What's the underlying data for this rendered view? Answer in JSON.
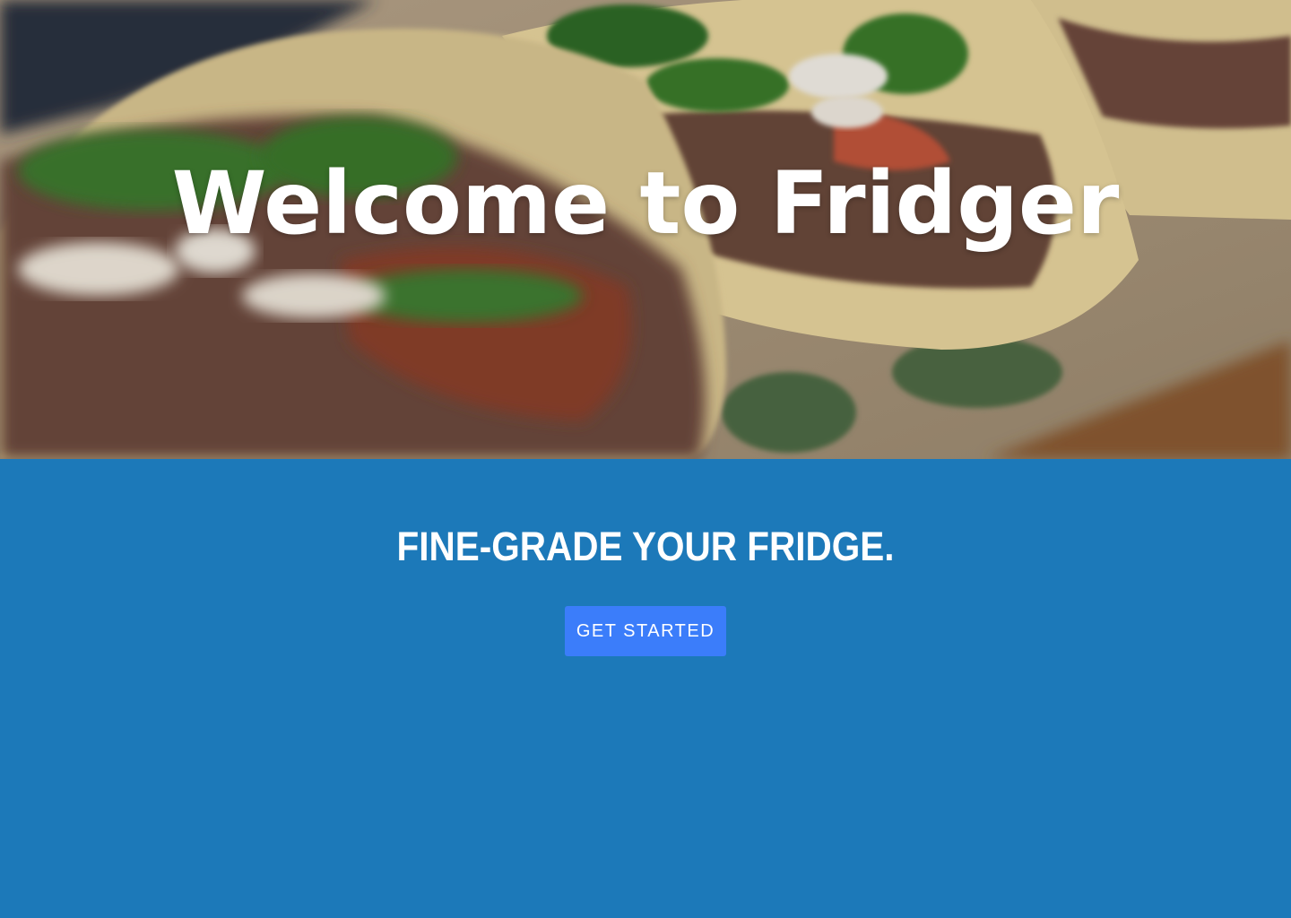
{
  "hero": {
    "title": "Welcome to Fridger"
  },
  "main": {
    "tagline": "FINE-GRADE YOUR FRIDGE.",
    "cta_label": "GET STARTED"
  },
  "colors": {
    "band_background": "#1c79b9",
    "button_background": "#3b7dfa",
    "text": "#ffffff"
  }
}
